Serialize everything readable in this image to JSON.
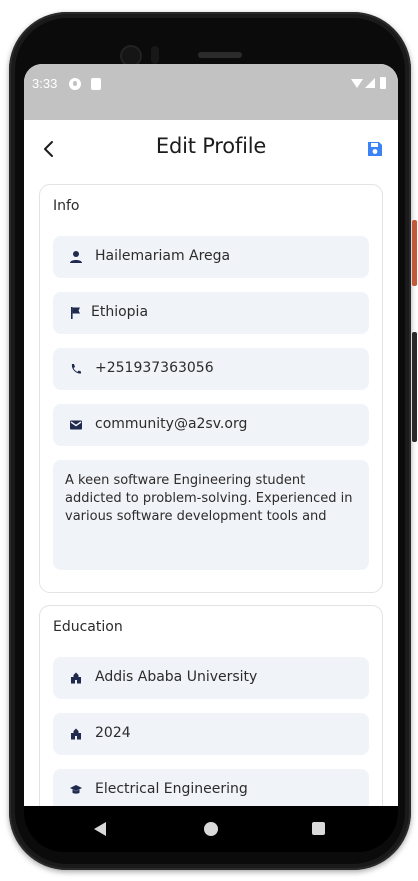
{
  "status_bar": {
    "time": "3:33",
    "icons": [
      "notification-icon",
      "sd-card-icon",
      "wifi-icon",
      "signal-icon",
      "battery-icon"
    ]
  },
  "app_bar": {
    "title": "Edit Profile",
    "back_icon": "chevron-left-icon",
    "save_icon": "save-icon",
    "accent_color": "#3b82f6"
  },
  "info": {
    "title": "Info",
    "name": "Hailemariam Arega",
    "country": "Ethiopia",
    "phone": "+251937363056",
    "email": "community@a2sv.org",
    "bio": "A keen software Engineering student addicted to problem-solving. Experienced in various software development tools and"
  },
  "education": {
    "title": "Education",
    "school": "Addis Ababa University",
    "year": "2024",
    "field": "Electrical Engineering"
  },
  "colors": {
    "field_bg": "#f0f3f7",
    "icon_color": "#1f2a4d",
    "status_bar": "#c2c2c2"
  }
}
